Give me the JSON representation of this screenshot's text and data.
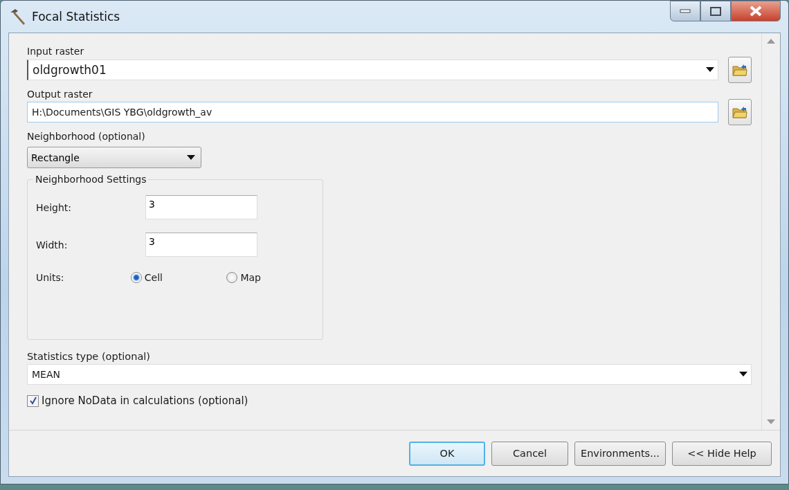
{
  "window": {
    "title": "Focal Statistics"
  },
  "input_raster": {
    "label": "Input raster",
    "value": "oldgrowth01"
  },
  "output_raster": {
    "label": "Output raster",
    "value": "H:\\Documents\\GIS YBG\\oldgrowth_av"
  },
  "neighborhood": {
    "label": "Neighborhood (optional)",
    "value": "Rectangle"
  },
  "neighborhood_settings": {
    "title": "Neighborhood Settings",
    "fields": [
      {
        "label": "Height:",
        "value": "3"
      },
      {
        "label": "Width:",
        "value": "3"
      }
    ],
    "units": {
      "label": "Units:",
      "options": [
        {
          "label": "Cell",
          "selected": true
        },
        {
          "label": "Map",
          "selected": false
        }
      ]
    }
  },
  "statistics_type": {
    "label": "Statistics type (optional)",
    "value": "MEAN"
  },
  "ignore_nodata": {
    "label": "Ignore NoData in calculations (optional)",
    "checked": true
  },
  "buttons": [
    {
      "label": "OK",
      "default": true
    },
    {
      "label": "Cancel",
      "default": false
    },
    {
      "label": "Environments...",
      "default": false
    },
    {
      "label": "<< Hide Help",
      "default": false
    }
  ]
}
